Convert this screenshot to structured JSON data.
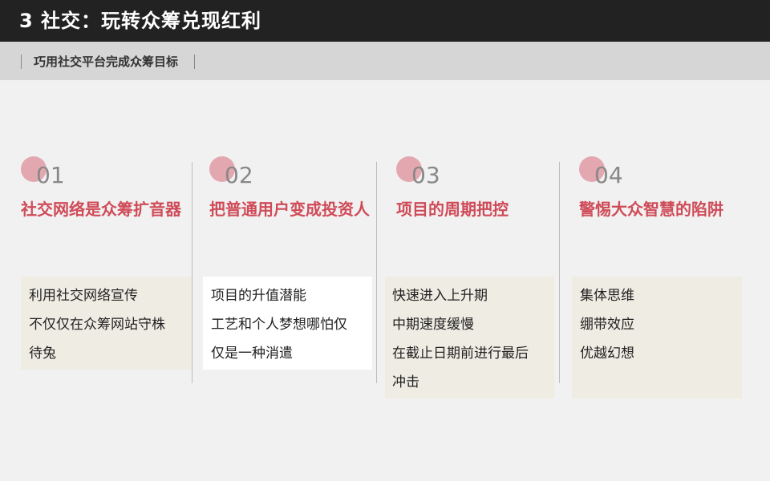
{
  "header": {
    "title": "3 社交：玩转众筹兑现红利"
  },
  "subheader": {
    "text": "巧用社交平台完成众筹目标"
  },
  "columns": [
    {
      "number": "01",
      "heading": "社交网络是众筹扩音器",
      "lines": [
        "利用社交网络宣传",
        "不仅仅在众筹网站守株",
        "待兔"
      ]
    },
    {
      "number": "02",
      "heading": "把普通用户变成投资人",
      "lines": [
        "项目的升值潜能",
        "工艺和个人梦想哪怕仅",
        "仅是一种消遣"
      ]
    },
    {
      "number": "03",
      "heading": "项目的周期把控",
      "lines": [
        "快速进入上升期",
        "中期速度缓慢",
        "在截止日期前进行最后",
        "冲击"
      ]
    },
    {
      "number": "04",
      "heading": "警惕大众智慧的陷阱",
      "lines": [
        "集体思维",
        "绷带效应",
        "优越幻想"
      ]
    }
  ],
  "colors": {
    "header_bg": "#222222",
    "subheader_bg": "#d6d6d6",
    "accent": "#cf4b58",
    "circle": "#e3a7b0",
    "box_bg": "#efece3"
  }
}
